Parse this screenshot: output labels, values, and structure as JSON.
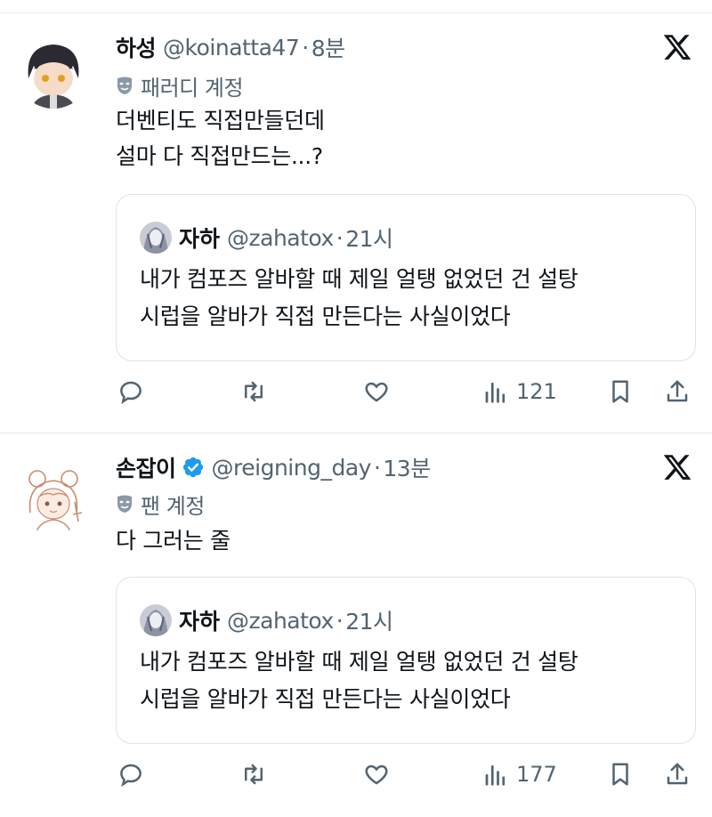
{
  "tweets": [
    {
      "display_name": "하성",
      "handle": "@koinatta47",
      "dot": "·",
      "time": "8분",
      "account_label": "패러디 계정",
      "text_lines": [
        "더벤티도 직접만들던데",
        "설마 다 직접만드는...?"
      ],
      "verified": false,
      "views": "121",
      "quote": {
        "display_name": "자하",
        "handle": "@zahatox",
        "dot": "·",
        "time": "21시",
        "text_lines": [
          "내가 컴포즈 알바할 때 제일 얼탱 없었던 건 설탕",
          "시럽을 알바가 직접 만든다는 사실이었다"
        ]
      }
    },
    {
      "display_name": "손잡이",
      "handle": "@reigning_day",
      "dot": "·",
      "time": "13분",
      "account_label": "팬 계정",
      "text_lines": [
        "다 그러는 줄"
      ],
      "verified": true,
      "views": "177",
      "quote": {
        "display_name": "자하",
        "handle": "@zahatox",
        "dot": "·",
        "time": "21시",
        "text_lines": [
          "내가 컴포즈 알바할 때 제일 얼탱 없었던 건 설탕",
          "시럽을 알바가 직접 만든다는 사실이었다"
        ]
      }
    }
  ],
  "icons": {
    "reply": "reply-icon",
    "retweet": "retweet-icon",
    "like": "heart-icon",
    "views": "views-chart-icon",
    "bookmark": "bookmark-icon",
    "share": "share-icon",
    "x_logo": "x-logo-icon",
    "verified": "verified-badge-icon",
    "account_badge": "mask-icon"
  },
  "colors": {
    "text": "#0f1419",
    "secondary": "#536471",
    "verified": "#1d9bf0",
    "border": "#dfe3e7"
  }
}
